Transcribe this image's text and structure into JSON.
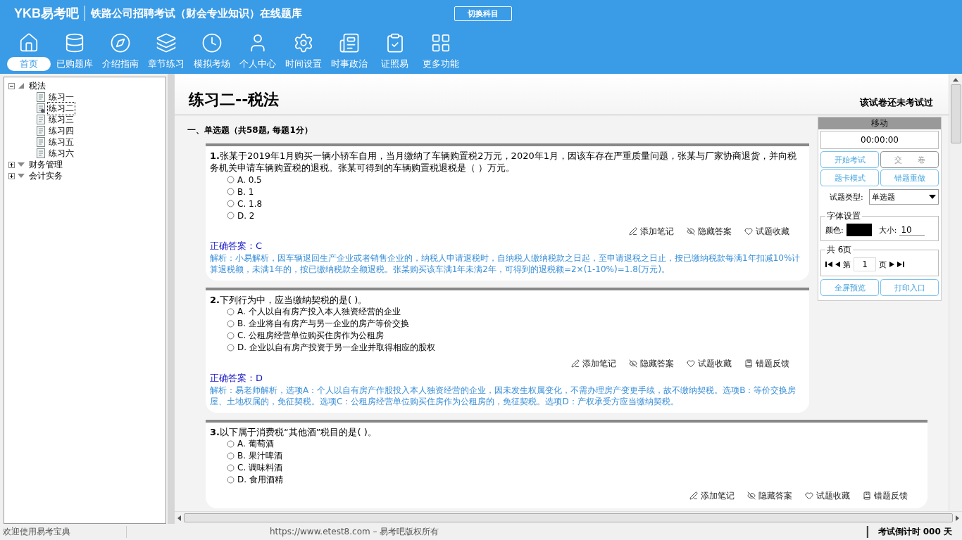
{
  "header": {
    "logo": "YKB易考吧",
    "title": "铁路公司招聘考试（财会专业知识）在线题库",
    "switch_button": "切换科目"
  },
  "nav": [
    {
      "label": "首页",
      "selected": true
    },
    {
      "label": "已购题库",
      "selected": false
    },
    {
      "label": "介绍指南",
      "selected": false
    },
    {
      "label": "章节练习",
      "selected": false
    },
    {
      "label": "模拟考场",
      "selected": false
    },
    {
      "label": "个人中心",
      "selected": false
    },
    {
      "label": "时间设置",
      "selected": false
    },
    {
      "label": "时事政治",
      "selected": false
    },
    {
      "label": "证照易",
      "selected": false
    },
    {
      "label": "更多功能",
      "selected": false
    }
  ],
  "tree": [
    {
      "label": "税法",
      "expanded": true,
      "children": [
        {
          "label": "练习一",
          "selected": false
        },
        {
          "label": "练习二",
          "selected": true
        },
        {
          "label": "练习三",
          "selected": false
        },
        {
          "label": "练习四",
          "selected": false
        },
        {
          "label": "练习五",
          "selected": false
        },
        {
          "label": "练习六",
          "selected": false
        }
      ]
    },
    {
      "label": "财务管理",
      "expanded": false
    },
    {
      "label": "会计实务",
      "expanded": false
    }
  ],
  "paper": {
    "title": "练习二--税法",
    "status": "该试卷还未考试过",
    "section": "一、单选题（共58题, 每题1分）"
  },
  "questions": [
    {
      "number": "1.",
      "text": "张某于2019年1月购买一辆小轿车自用，当月缴纳了车辆购置税2万元，2020年1月，因该车存在严重质量问题，张某与厂家协商退货，并向税务机关申请车辆购置税的退税。张某可得到的车辆购置税退税是（ ）万元。",
      "options": [
        {
          "label": "A. 0.5",
          "selected": false
        },
        {
          "label": "B. 1",
          "selected": false
        },
        {
          "label": "C. 1.8",
          "selected": false
        },
        {
          "label": "D. 2",
          "selected": false
        }
      ],
      "actions": [
        "添加笔记",
        "隐藏答案",
        "试题收藏"
      ],
      "answer": "正确答案：C",
      "analysis": "解析：小易解析，因车辆退回生产企业或者销售企业的，纳税人申请退税时，自纳税人缴纳税款之日起，至申请退税之日止，按已缴纳税款每满1年扣减10%计算退税额，未满1年的，按已缴纳税款全额退税。张某购买该车满1年未满2年，可得到的退税额=2×(1-10%)=1.8(万元)。"
    },
    {
      "number": "2.",
      "text": "下列行为中，应当缴纳契税的是( )。",
      "options": [
        {
          "label": "A. 个人以自有房产投入本人独资经营的企业",
          "selected": false
        },
        {
          "label": "B. 企业将自有房产与另一企业的房产等价交换",
          "selected": false
        },
        {
          "label": "C. 公租房经营单位购买住房作为公租房",
          "selected": false
        },
        {
          "label": "D. 企业以自有房产投资于另一企业并取得相应的股权",
          "selected": false
        }
      ],
      "actions": [
        "添加笔记",
        "隐藏答案",
        "试题收藏",
        "错题反馈"
      ],
      "answer": "正确答案：D",
      "analysis": "解析：易老师解析，选项A：个人以自有房产作股投入本人独资经营的企业，因未发生权属变化，不需办理房产变更手续，故不缴纳契税。选项B：等价交换房屋、土地权属的，免征契税。选项C：公租房经营单位购买住房作为公租房的，免征契税。选项D：产权承受方应当缴纳契税。"
    },
    {
      "number": "3.",
      "text": "以下属于消费税“其他酒”税目的是( )。",
      "options": [
        {
          "label": "A. 葡萄酒",
          "selected": false
        },
        {
          "label": "B. 果汁啤酒",
          "selected": false
        },
        {
          "label": "C. 调味料酒",
          "selected": false
        },
        {
          "label": "D. 食用酒精",
          "selected": false
        }
      ],
      "actions": [
        "添加笔记",
        "隐藏答案",
        "试题收藏",
        "错题反馈"
      ]
    }
  ],
  "panel": {
    "title": "移动",
    "timer": "00:00:00",
    "buttons": [
      {
        "label": "开始考试",
        "disabled": false
      },
      {
        "label": "交　　卷",
        "disabled": true
      },
      {
        "label": "题卡模式",
        "disabled": false
      },
      {
        "label": "错题重做",
        "disabled": false
      }
    ],
    "type_label": "试题类型:",
    "type_value": "单选题",
    "font_group": "字体设置",
    "color_label": "颜色:",
    "size_label": "大小:",
    "size_value": "10",
    "pages_group": "共 6页",
    "page_prefix": "第",
    "page_value": "1",
    "page_suffix": "页",
    "bottom_buttons": [
      "全屏预览",
      "打印入口"
    ]
  },
  "status": {
    "welcome": "欢迎使用易考宝典",
    "copyright": "https://www.etest8.com – 易考吧版权所有",
    "countdown": "考试倒计时 000 天"
  }
}
